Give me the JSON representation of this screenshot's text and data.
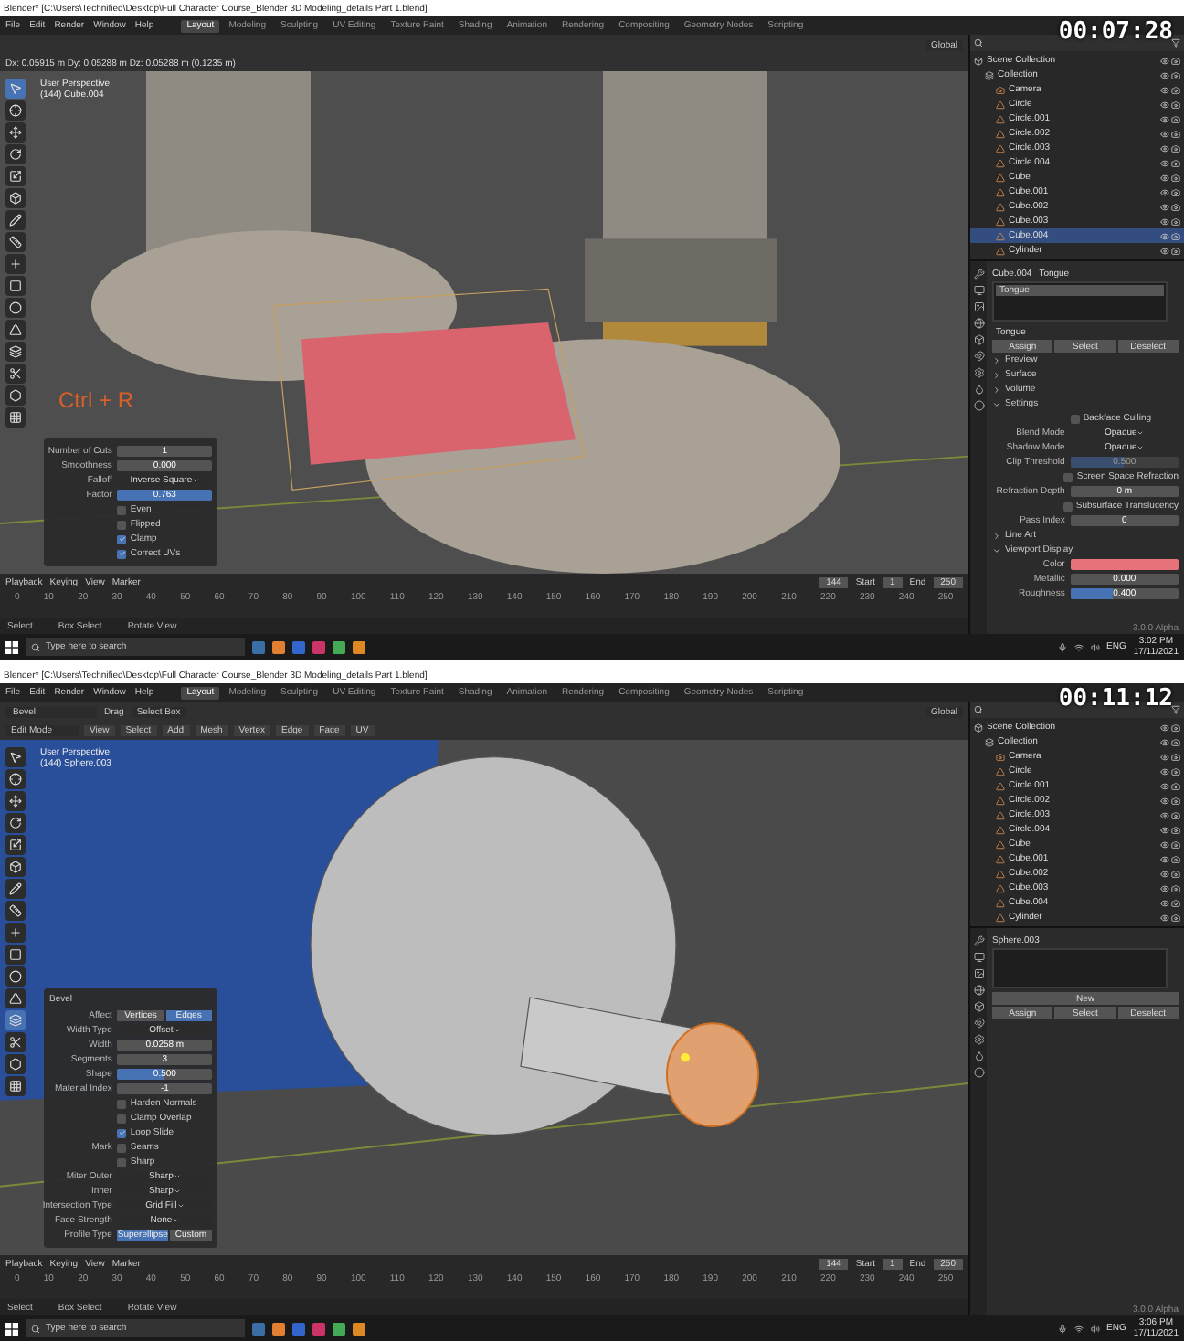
{
  "frames": [
    {
      "timer": "00:07:28",
      "title": "Blender* [C:\\Users\\Technified\\Desktop\\Full Character Course_Blender 3D Modeling_details Part 1.blend]",
      "menus": [
        "File",
        "Edit",
        "Render",
        "Window",
        "Help"
      ],
      "workspaces": [
        {
          "label": "Layout",
          "selected": true
        },
        {
          "label": "Modeling",
          "selected": false
        },
        {
          "label": "Sculpting",
          "selected": false
        },
        {
          "label": "UV Editing",
          "selected": false
        },
        {
          "label": "Texture Paint",
          "selected": false
        },
        {
          "label": "Shading",
          "selected": false
        },
        {
          "label": "Animation",
          "selected": false
        },
        {
          "label": "Rendering",
          "selected": false
        },
        {
          "label": "Compositing",
          "selected": false
        },
        {
          "label": "Geometry Nodes",
          "selected": false
        },
        {
          "label": "Scripting",
          "selected": false
        }
      ],
      "header": {
        "orientation": "Global",
        "info": "Dx: 0.05915 m  Dy: 0.05288 m  Dz: 0.05288 m (0.1235 m)"
      },
      "kind": "legs",
      "viewport_info": [
        "User Perspective",
        "(144) Cube.004"
      ],
      "shortcut": "Ctrl + R",
      "toolbar_tools": [
        {
          "selected": true
        },
        {
          "selected": false
        },
        {
          "selected": false
        },
        {
          "selected": false
        },
        {
          "selected": false
        },
        {
          "selected": false
        },
        {
          "selected": false
        },
        {
          "selected": false
        },
        {
          "selected": false
        },
        {
          "selected": false
        },
        {
          "selected": false
        },
        {
          "selected": false
        },
        {
          "selected": false
        },
        {
          "selected": false
        },
        {
          "selected": false
        },
        {
          "selected": false
        }
      ],
      "operator_panel": {
        "rows": [
          {
            "kind": "field",
            "label": "Number of Cuts",
            "value": "1"
          },
          {
            "kind": "field",
            "label": "Smoothness",
            "value": "0.000"
          },
          {
            "kind": "dropdown",
            "label": "Falloff",
            "value": "Inverse Square"
          },
          {
            "kind": "field",
            "label": "Factor",
            "value": "0.763",
            "active": true
          },
          {
            "kind": "check",
            "label": "Even",
            "checked": false
          },
          {
            "kind": "check",
            "label": "Flipped",
            "checked": false
          },
          {
            "kind": "check",
            "label": "Clamp",
            "checked": true
          },
          {
            "kind": "check",
            "label": "Correct UVs",
            "checked": true
          }
        ]
      },
      "timeline": {
        "menus": [
          "Playback",
          "Keying",
          "View",
          "Marker"
        ],
        "ticks": [
          "0",
          "10",
          "20",
          "30",
          "40",
          "50",
          "60",
          "70",
          "80",
          "90",
          "100",
          "110",
          "120",
          "130",
          "140",
          "150",
          "160",
          "170",
          "180",
          "190",
          "200",
          "210",
          "220",
          "230",
          "240",
          "250"
        ],
        "current": "144",
        "start_label": "Start",
        "start": "1",
        "end_label": "End",
        "end": "250"
      },
      "status_bar": [
        "Select",
        "Box Select",
        "Rotate View"
      ],
      "version": "3.0.0 Alpha",
      "taskbar": {
        "search": "Type here to search",
        "language": "ENG",
        "time": "3:02 PM",
        "date": "17/11/2021"
      },
      "outliner": [
        {
          "label": "Scene Collection",
          "kind": "scene",
          "selected": false,
          "children": [
            {
              "label": "Collection",
              "kind": "collection",
              "selected": false,
              "children": [
                {
                  "label": "Camera",
                  "kind": "camera",
                  "selected": false
                },
                {
                  "label": "Circle",
                  "kind": "mesh",
                  "selected": false
                },
                {
                  "label": "Circle.001",
                  "kind": "mesh",
                  "selected": false
                },
                {
                  "label": "Circle.002",
                  "kind": "mesh",
                  "selected": false
                },
                {
                  "label": "Circle.003",
                  "kind": "mesh",
                  "selected": false
                },
                {
                  "label": "Circle.004",
                  "kind": "mesh",
                  "selected": false
                },
                {
                  "label": "Cube",
                  "kind": "mesh",
                  "selected": false
                },
                {
                  "label": "Cube.001",
                  "kind": "mesh",
                  "selected": false
                },
                {
                  "label": "Cube.002",
                  "kind": "mesh",
                  "selected": false
                },
                {
                  "label": "Cube.003",
                  "kind": "mesh",
                  "selected": false
                },
                {
                  "label": "Cube.004",
                  "kind": "mesh",
                  "selected": true
                },
                {
                  "label": "Cylinder",
                  "kind": "mesh",
                  "selected": false
                }
              ]
            }
          ]
        }
      ],
      "properties": [
        {
          "kind": "object",
          "object": "Cube.004",
          "material": "Tongue"
        },
        {
          "kind": "slots",
          "items": [
            {
              "label": "Tongue",
              "selected": true
            }
          ]
        },
        {
          "kind": "material",
          "value": "Tongue"
        },
        {
          "kind": "buttons",
          "labels": [
            "Assign",
            "Select",
            "Deselect"
          ]
        },
        {
          "kind": "section",
          "label": "Preview",
          "expanded": false
        },
        {
          "kind": "section",
          "label": "Surface",
          "expanded": false
        },
        {
          "kind": "section",
          "label": "Volume",
          "expanded": false
        },
        {
          "kind": "section",
          "label": "Settings",
          "expanded": true
        },
        {
          "kind": "check",
          "label": "Backface Culling",
          "checked": false
        },
        {
          "kind": "dropdown",
          "label": "Blend Mode",
          "value": "Opaque"
        },
        {
          "kind": "dropdown",
          "label": "Shadow Mode",
          "value": "Opaque"
        },
        {
          "kind": "field",
          "label": "Clip Threshold",
          "value": "0.500",
          "level": 0.5,
          "disabled": true
        },
        {
          "kind": "check",
          "label": "Screen Space Refraction",
          "checked": false
        },
        {
          "kind": "field",
          "label": "Refraction Depth",
          "value": "0 m"
        },
        {
          "kind": "check",
          "label": "Subsurface Translucency",
          "checked": false
        },
        {
          "kind": "field",
          "label": "Pass Index",
          "value": "0"
        },
        {
          "kind": "section",
          "label": "Line Art",
          "expanded": false
        },
        {
          "kind": "section",
          "label": "Viewport Display",
          "expanded": true
        },
        {
          "kind": "color",
          "label": "Color",
          "color": "#e8727a"
        },
        {
          "kind": "field",
          "label": "Metallic",
          "value": "0.000"
        },
        {
          "kind": "field",
          "label": "Roughness",
          "value": "0.400",
          "level": 0.4
        }
      ]
    },
    {
      "timer": "00:11:12",
      "title": "Blender* [C:\\Users\\Technified\\Desktop\\Full Character Course_Blender 3D Modeling_details Part 1.blend]",
      "menus": [
        "File",
        "Edit",
        "Render",
        "Window",
        "Help"
      ],
      "workspaces": [
        {
          "label": "Layout",
          "selected": true
        },
        {
          "label": "Modeling",
          "selected": false
        },
        {
          "label": "Sculpting",
          "selected": false
        },
        {
          "label": "UV Editing",
          "selected": false
        },
        {
          "label": "Texture Paint",
          "selected": false
        },
        {
          "label": "Shading",
          "selected": false
        },
        {
          "label": "Animation",
          "selected": false
        },
        {
          "label": "Rendering",
          "selected": false
        },
        {
          "label": "Compositing",
          "selected": false
        },
        {
          "label": "Geometry Nodes",
          "selected": false
        },
        {
          "label": "Scripting",
          "selected": false
        }
      ],
      "header": {
        "tool": "Bevel",
        "drag_label": "Drag",
        "drag": "Select Box",
        "orientation": "Global",
        "mode": "Edit Mode",
        "tool_menus": [
          "View",
          "Select",
          "Add",
          "Mesh",
          "Vertex",
          "Edge",
          "Face",
          "UV"
        ]
      },
      "kind": "sphere",
      "viewport_info": [
        "User Perspective",
        "(144) Sphere.003"
      ],
      "toolbar_tools": [
        {
          "selected": false
        },
        {
          "selected": false
        },
        {
          "selected": false
        },
        {
          "selected": false
        },
        {
          "selected": false
        },
        {
          "selected": false
        },
        {
          "selected": false
        },
        {
          "selected": false
        },
        {
          "selected": false
        },
        {
          "selected": false
        },
        {
          "selected": false
        },
        {
          "selected": false
        },
        {
          "selected": true
        },
        {
          "selected": false
        },
        {
          "selected": false
        },
        {
          "selected": false
        }
      ],
      "operator_panel": {
        "title": "Bevel",
        "rows": [
          {
            "kind": "segmented",
            "label": "Affect",
            "options": [
              {
                "label": "Vertices",
                "selected": false
              },
              {
                "label": "Edges",
                "selected": true
              }
            ]
          },
          {
            "kind": "dropdown",
            "label": "Width Type",
            "value": "Offset"
          },
          {
            "kind": "field",
            "label": "Width",
            "value": "0.0258 m"
          },
          {
            "kind": "field",
            "label": "Segments",
            "value": "3"
          },
          {
            "kind": "field",
            "label": "Shape",
            "value": "0.500",
            "level": 0.5
          },
          {
            "kind": "field",
            "label": "Material Index",
            "value": "-1"
          },
          {
            "kind": "check",
            "label": "Harden Normals",
            "checked": false
          },
          {
            "kind": "check",
            "label": "Clamp Overlap",
            "checked": false
          },
          {
            "kind": "check",
            "label": "Loop Slide",
            "checked": true
          },
          {
            "kind": "check",
            "label": "Seams",
            "checked": false,
            "group": "Mark"
          },
          {
            "kind": "check",
            "label": "Sharp",
            "checked": false
          },
          {
            "kind": "dropdown",
            "label": "Miter Outer",
            "value": "Sharp"
          },
          {
            "kind": "dropdown",
            "label": "Inner",
            "value": "Sharp"
          },
          {
            "kind": "dropdown",
            "label": "Intersection Type",
            "value": "Grid Fill"
          },
          {
            "kind": "dropdown",
            "label": "Face Strength",
            "value": "None"
          },
          {
            "kind": "segmented",
            "label": "Profile Type",
            "options": [
              {
                "label": "Superellipse",
                "selected": true
              },
              {
                "label": "Custom",
                "selected": false
              }
            ]
          }
        ]
      },
      "timeline": {
        "menus": [
          "Playback",
          "Keying",
          "View",
          "Marker"
        ],
        "ticks": [
          "0",
          "10",
          "20",
          "30",
          "40",
          "50",
          "60",
          "70",
          "80",
          "90",
          "100",
          "110",
          "120",
          "130",
          "140",
          "150",
          "160",
          "170",
          "180",
          "190",
          "200",
          "210",
          "220",
          "230",
          "240",
          "250"
        ],
        "current": "144",
        "start_label": "Start",
        "start": "1",
        "end_label": "End",
        "end": "250"
      },
      "status_bar": [
        "Select",
        "Box Select",
        "Rotate View"
      ],
      "version": "3.0.0 Alpha",
      "taskbar": {
        "search": "Type here to search",
        "language": "ENG",
        "time": "3:06 PM",
        "date": "17/11/2021"
      },
      "outliner": [
        {
          "label": "Scene Collection",
          "kind": "scene",
          "selected": false,
          "children": [
            {
              "label": "Collection",
              "kind": "collection",
              "selected": false,
              "children": [
                {
                  "label": "Camera",
                  "kind": "camera",
                  "selected": false
                },
                {
                  "label": "Circle",
                  "kind": "mesh",
                  "selected": false
                },
                {
                  "label": "Circle.001",
                  "kind": "mesh",
                  "selected": false
                },
                {
                  "label": "Circle.002",
                  "kind": "mesh",
                  "selected": false
                },
                {
                  "label": "Circle.003",
                  "kind": "mesh",
                  "selected": false
                },
                {
                  "label": "Circle.004",
                  "kind": "mesh",
                  "selected": false
                },
                {
                  "label": "Cube",
                  "kind": "mesh",
                  "selected": false
                },
                {
                  "label": "Cube.001",
                  "kind": "mesh",
                  "selected": false
                },
                {
                  "label": "Cube.002",
                  "kind": "mesh",
                  "selected": false
                },
                {
                  "label": "Cube.003",
                  "kind": "mesh",
                  "selected": false
                },
                {
                  "label": "Cube.004",
                  "kind": "mesh",
                  "selected": false
                },
                {
                  "label": "Cylinder",
                  "kind": "mesh",
                  "selected": false
                }
              ]
            }
          ]
        }
      ],
      "properties": [
        {
          "kind": "object",
          "object": "Sphere.003"
        },
        {
          "kind": "slots"
        },
        {
          "kind": "new",
          "label": "New"
        },
        {
          "kind": "buttons",
          "labels": [
            "Assign",
            "Select",
            "Deselect"
          ]
        }
      ]
    }
  ]
}
